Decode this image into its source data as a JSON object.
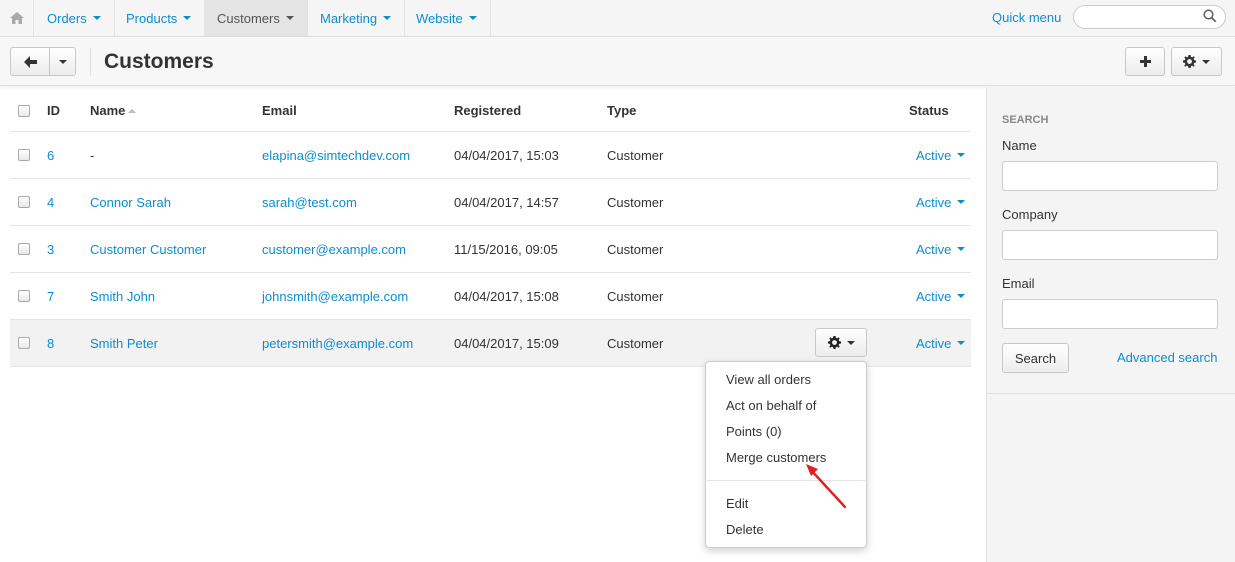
{
  "nav": {
    "items": [
      {
        "label": "Orders"
      },
      {
        "label": "Products"
      },
      {
        "label": "Customers"
      },
      {
        "label": "Marketing"
      },
      {
        "label": "Website"
      }
    ],
    "quick_menu": "Quick menu",
    "search_placeholder": ""
  },
  "header": {
    "title": "Customers"
  },
  "table": {
    "columns": {
      "id": "ID",
      "name": "Name",
      "email": "Email",
      "registered": "Registered",
      "type": "Type",
      "status": "Status"
    },
    "rows": [
      {
        "id": "6",
        "name": "-",
        "email": "elapina@simtechdev.com",
        "registered": "04/04/2017, 15:03",
        "type": "Customer",
        "status": "Active"
      },
      {
        "id": "4",
        "name": "Connor Sarah",
        "email": "sarah@test.com",
        "registered": "04/04/2017, 14:57",
        "type": "Customer",
        "status": "Active"
      },
      {
        "id": "3",
        "name": "Customer Customer",
        "email": "customer@example.com",
        "registered": "11/15/2016, 09:05",
        "type": "Customer",
        "status": "Active"
      },
      {
        "id": "7",
        "name": "Smith John",
        "email": "johnsmith@example.com",
        "registered": "04/04/2017, 15:08",
        "type": "Customer",
        "status": "Active"
      },
      {
        "id": "8",
        "name": "Smith Peter",
        "email": "petersmith@example.com",
        "registered": "04/04/2017, 15:09",
        "type": "Customer",
        "status": "Active"
      }
    ]
  },
  "dropdown": {
    "items": [
      "View all orders",
      "Act on behalf of",
      "Points (0)",
      "Merge customers",
      "Edit",
      "Delete"
    ]
  },
  "sidebar": {
    "heading": "Search",
    "name_label": "Name",
    "company_label": "Company",
    "email_label": "Email",
    "search_button": "Search",
    "advanced_search": "Advanced search"
  },
  "colors": {
    "link": "#0b8ed0",
    "annotation_arrow": "#e02020"
  }
}
